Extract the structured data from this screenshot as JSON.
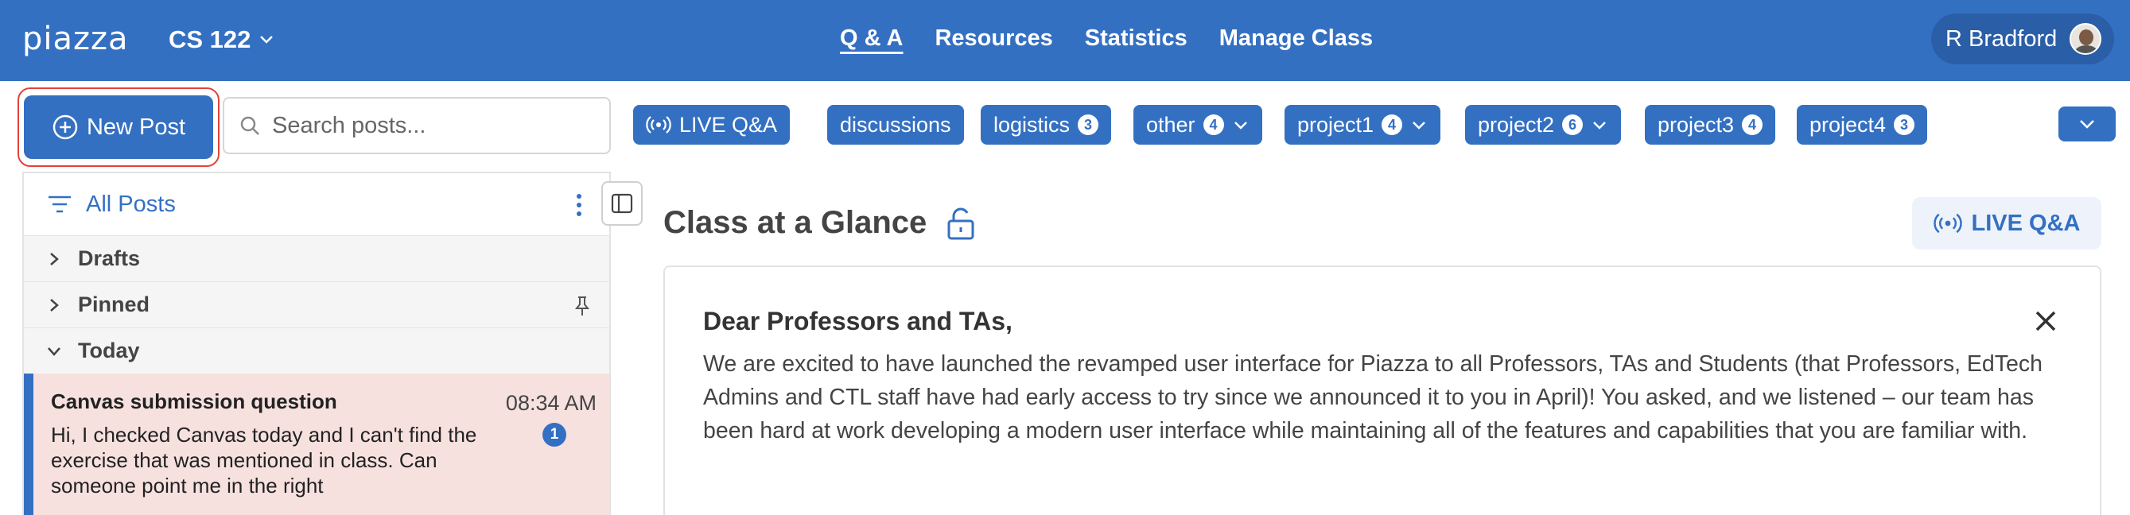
{
  "header": {
    "logo": "piazza",
    "class_name": "CS 122",
    "nav": [
      {
        "label": "Q & A",
        "active": true
      },
      {
        "label": "Resources",
        "active": false
      },
      {
        "label": "Statistics",
        "active": false
      },
      {
        "label": "Manage Class",
        "active": false
      }
    ],
    "user_name": "R Bradford"
  },
  "toolbar": {
    "new_post_label": "New Post",
    "search_placeholder": "Search posts...",
    "live_qa_label": "LIVE Q&A",
    "folders": [
      {
        "label": "discussions",
        "count": "",
        "dropdown": false
      },
      {
        "label": "logistics",
        "count": "3",
        "dropdown": false
      },
      {
        "label": "other",
        "count": "4",
        "dropdown": true
      },
      {
        "label": "project1",
        "count": "4",
        "dropdown": true
      },
      {
        "label": "project2",
        "count": "6",
        "dropdown": true
      },
      {
        "label": "project3",
        "count": "4",
        "dropdown": false
      },
      {
        "label": "project4",
        "count": "3",
        "dropdown": false
      }
    ]
  },
  "feed": {
    "filter_label": "All Posts",
    "groups": [
      {
        "label": "Drafts",
        "expanded": false
      },
      {
        "label": "Pinned",
        "expanded": false
      },
      {
        "label": "Today",
        "expanded": true
      }
    ],
    "posts": [
      {
        "title": "Canvas submission question",
        "time": "08:34 AM",
        "body": "Hi, I checked Canvas today and I can't find the exercise that was mentioned in class. Can someone point me in the right",
        "unread": "1"
      }
    ]
  },
  "main": {
    "title": "Class at a Glance",
    "live_button_label": "LIVE Q&A",
    "notice": {
      "heading": "Dear Professors and TAs,",
      "body": "We are excited to have launched the revamped user interface for Piazza to all Professors, TAs and Students (that Professors, EdTech Admins and CTL staff have had early access to try since we announced it to you in April)! You asked, and we listened – our team has been hard at work developing a modern user interface while maintaining all of the features and capabilities that you are familiar with."
    }
  },
  "colors": {
    "brand_blue": "#3470c2",
    "highlight_red": "#e2433a",
    "selected_post_bg": "#f7e1df"
  }
}
